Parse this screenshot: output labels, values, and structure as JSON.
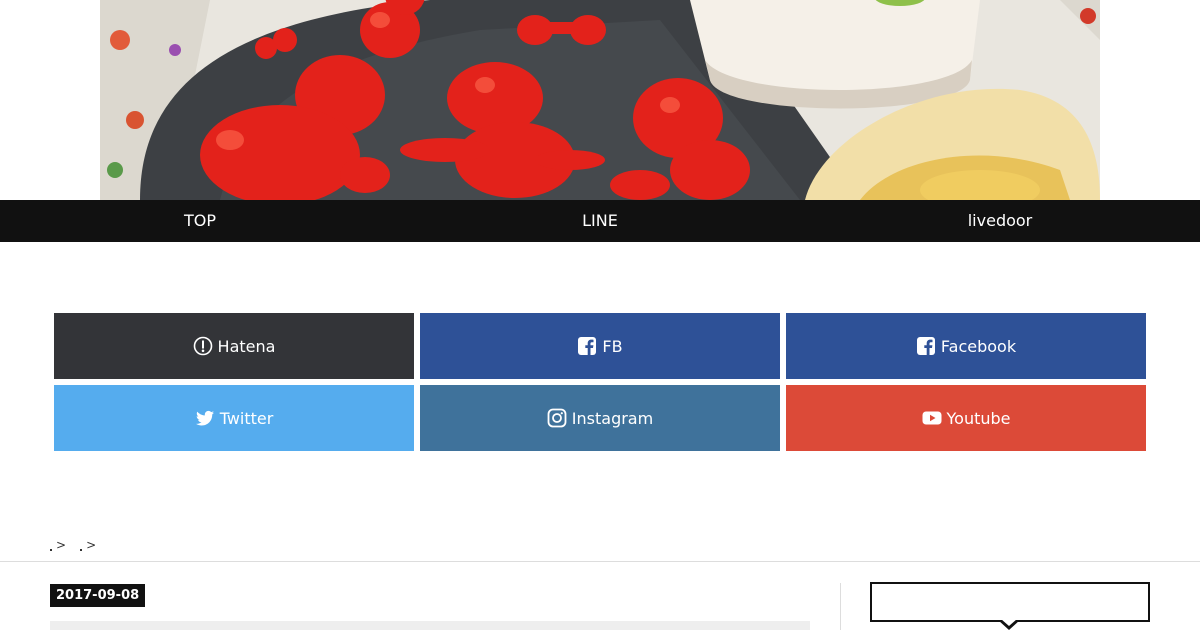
{
  "hero": {
    "image_description": ""
  },
  "nav": {
    "items": [
      {
        "label": "TOP"
      },
      {
        "label": "LINE"
      },
      {
        "label": "livedoor"
      }
    ]
  },
  "social": {
    "buttons": [
      {
        "label": "Hatena",
        "icon": "hatena-icon",
        "color": "#333438"
      },
      {
        "label": "FB",
        "icon": "facebook-icon",
        "color": "#2e5197"
      },
      {
        "label": "Facebook",
        "icon": "facebook-icon",
        "color": "#2e5197"
      },
      {
        "label": "Twitter",
        "icon": "twitter-icon",
        "color": "#55acee"
      },
      {
        "label": "Instagram",
        "icon": "instagram-icon",
        "color": "#3f729b"
      },
      {
        "label": "Youtube",
        "icon": "youtube-icon",
        "color": "#dc4a38"
      }
    ]
  },
  "breadcrumb": {
    "separators": [
      ">",
      ">"
    ]
  },
  "article": {
    "date": "2017-09-08"
  }
}
